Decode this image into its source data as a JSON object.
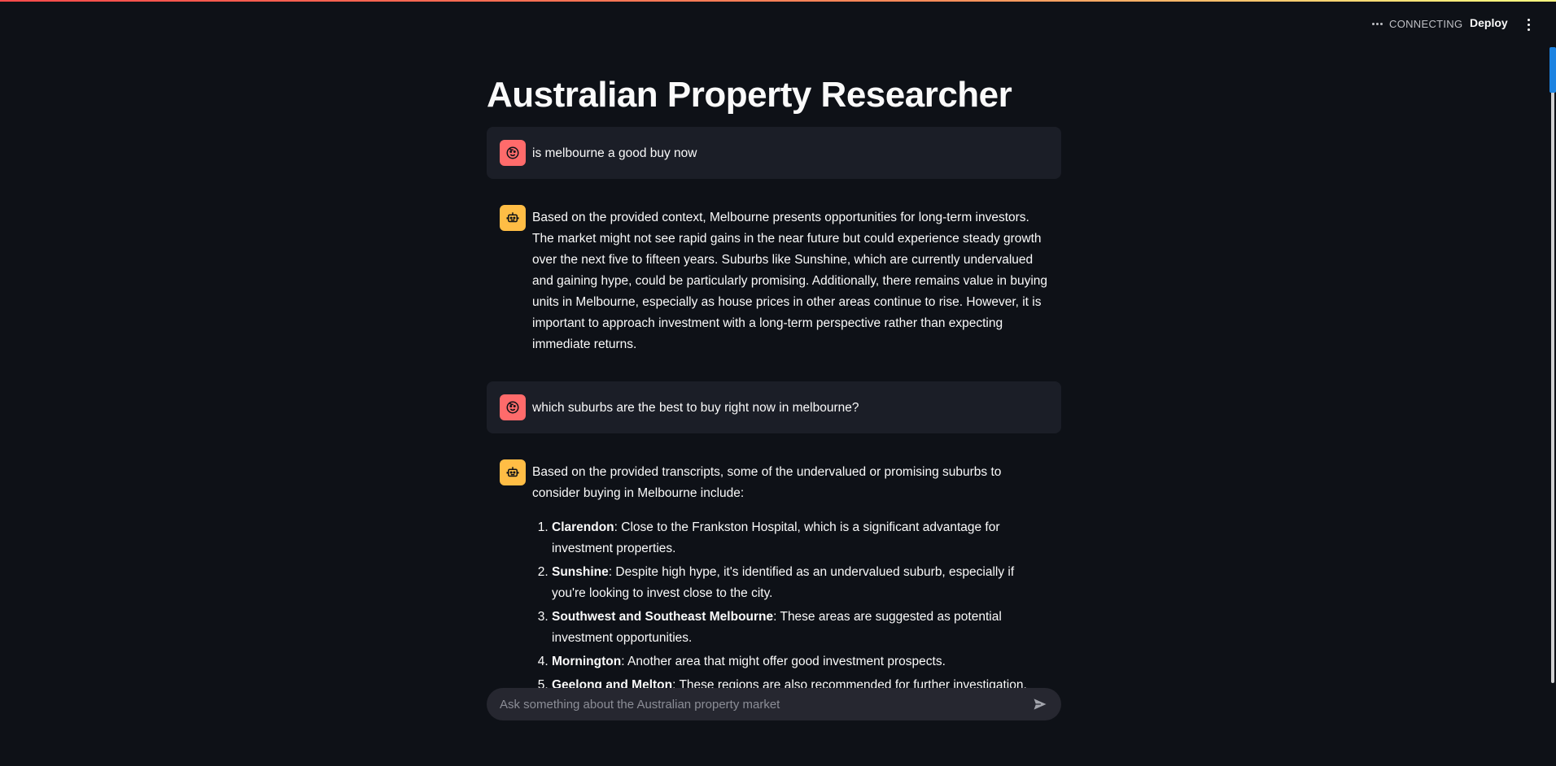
{
  "header": {
    "status": "CONNECTING",
    "deploy_label": "Deploy"
  },
  "page": {
    "title": "Australian Property Researcher"
  },
  "messages": [
    {
      "role": "user",
      "text": "is melbourne a good buy now"
    },
    {
      "role": "assistant",
      "text": "Based on the provided context, Melbourne presents opportunities for long-term investors. The market might not see rapid gains in the near future but could experience steady growth over the next five to fifteen years. Suburbs like Sunshine, which are currently undervalued and gaining hype, could be particularly promising. Additionally, there remains value in buying units in Melbourne, especially as house prices in other areas continue to rise. However, it is important to approach investment with a long-term perspective rather than expecting immediate returns."
    },
    {
      "role": "user",
      "text": "which suburbs are the best to buy right now in melbourne?"
    },
    {
      "role": "assistant",
      "intro": "Based on the provided transcripts, some of the undervalued or promising suburbs to consider buying in Melbourne include:",
      "items": [
        {
          "name": "Clarendon",
          "desc": ": Close to the Frankston Hospital, which is a significant advantage for investment properties."
        },
        {
          "name": "Sunshine",
          "desc": ": Despite high hype, it's identified as an undervalued suburb, especially if you're looking to invest close to the city."
        },
        {
          "name": "Southwest and Southeast Melbourne",
          "desc": ": These areas are suggested as potential investment opportunities."
        },
        {
          "name": "Mornington",
          "desc": ": Another area that might offer good investment prospects."
        },
        {
          "name": "Geelong and Melton",
          "desc": ": These regions are also recommended for further investigation."
        }
      ]
    }
  ],
  "chat_input": {
    "placeholder": "Ask something about the Australian property market"
  },
  "colors": {
    "background": "#0e1117",
    "user_bubble": "#1b1e27",
    "user_avatar": "#ff6b6b",
    "assistant_avatar": "#ffbd45",
    "input_bg": "#262730"
  },
  "icons": {
    "user_avatar": "smiley-face-icon",
    "assistant_avatar": "robot-icon",
    "send": "send-icon",
    "menu": "vertical-dots-icon"
  }
}
